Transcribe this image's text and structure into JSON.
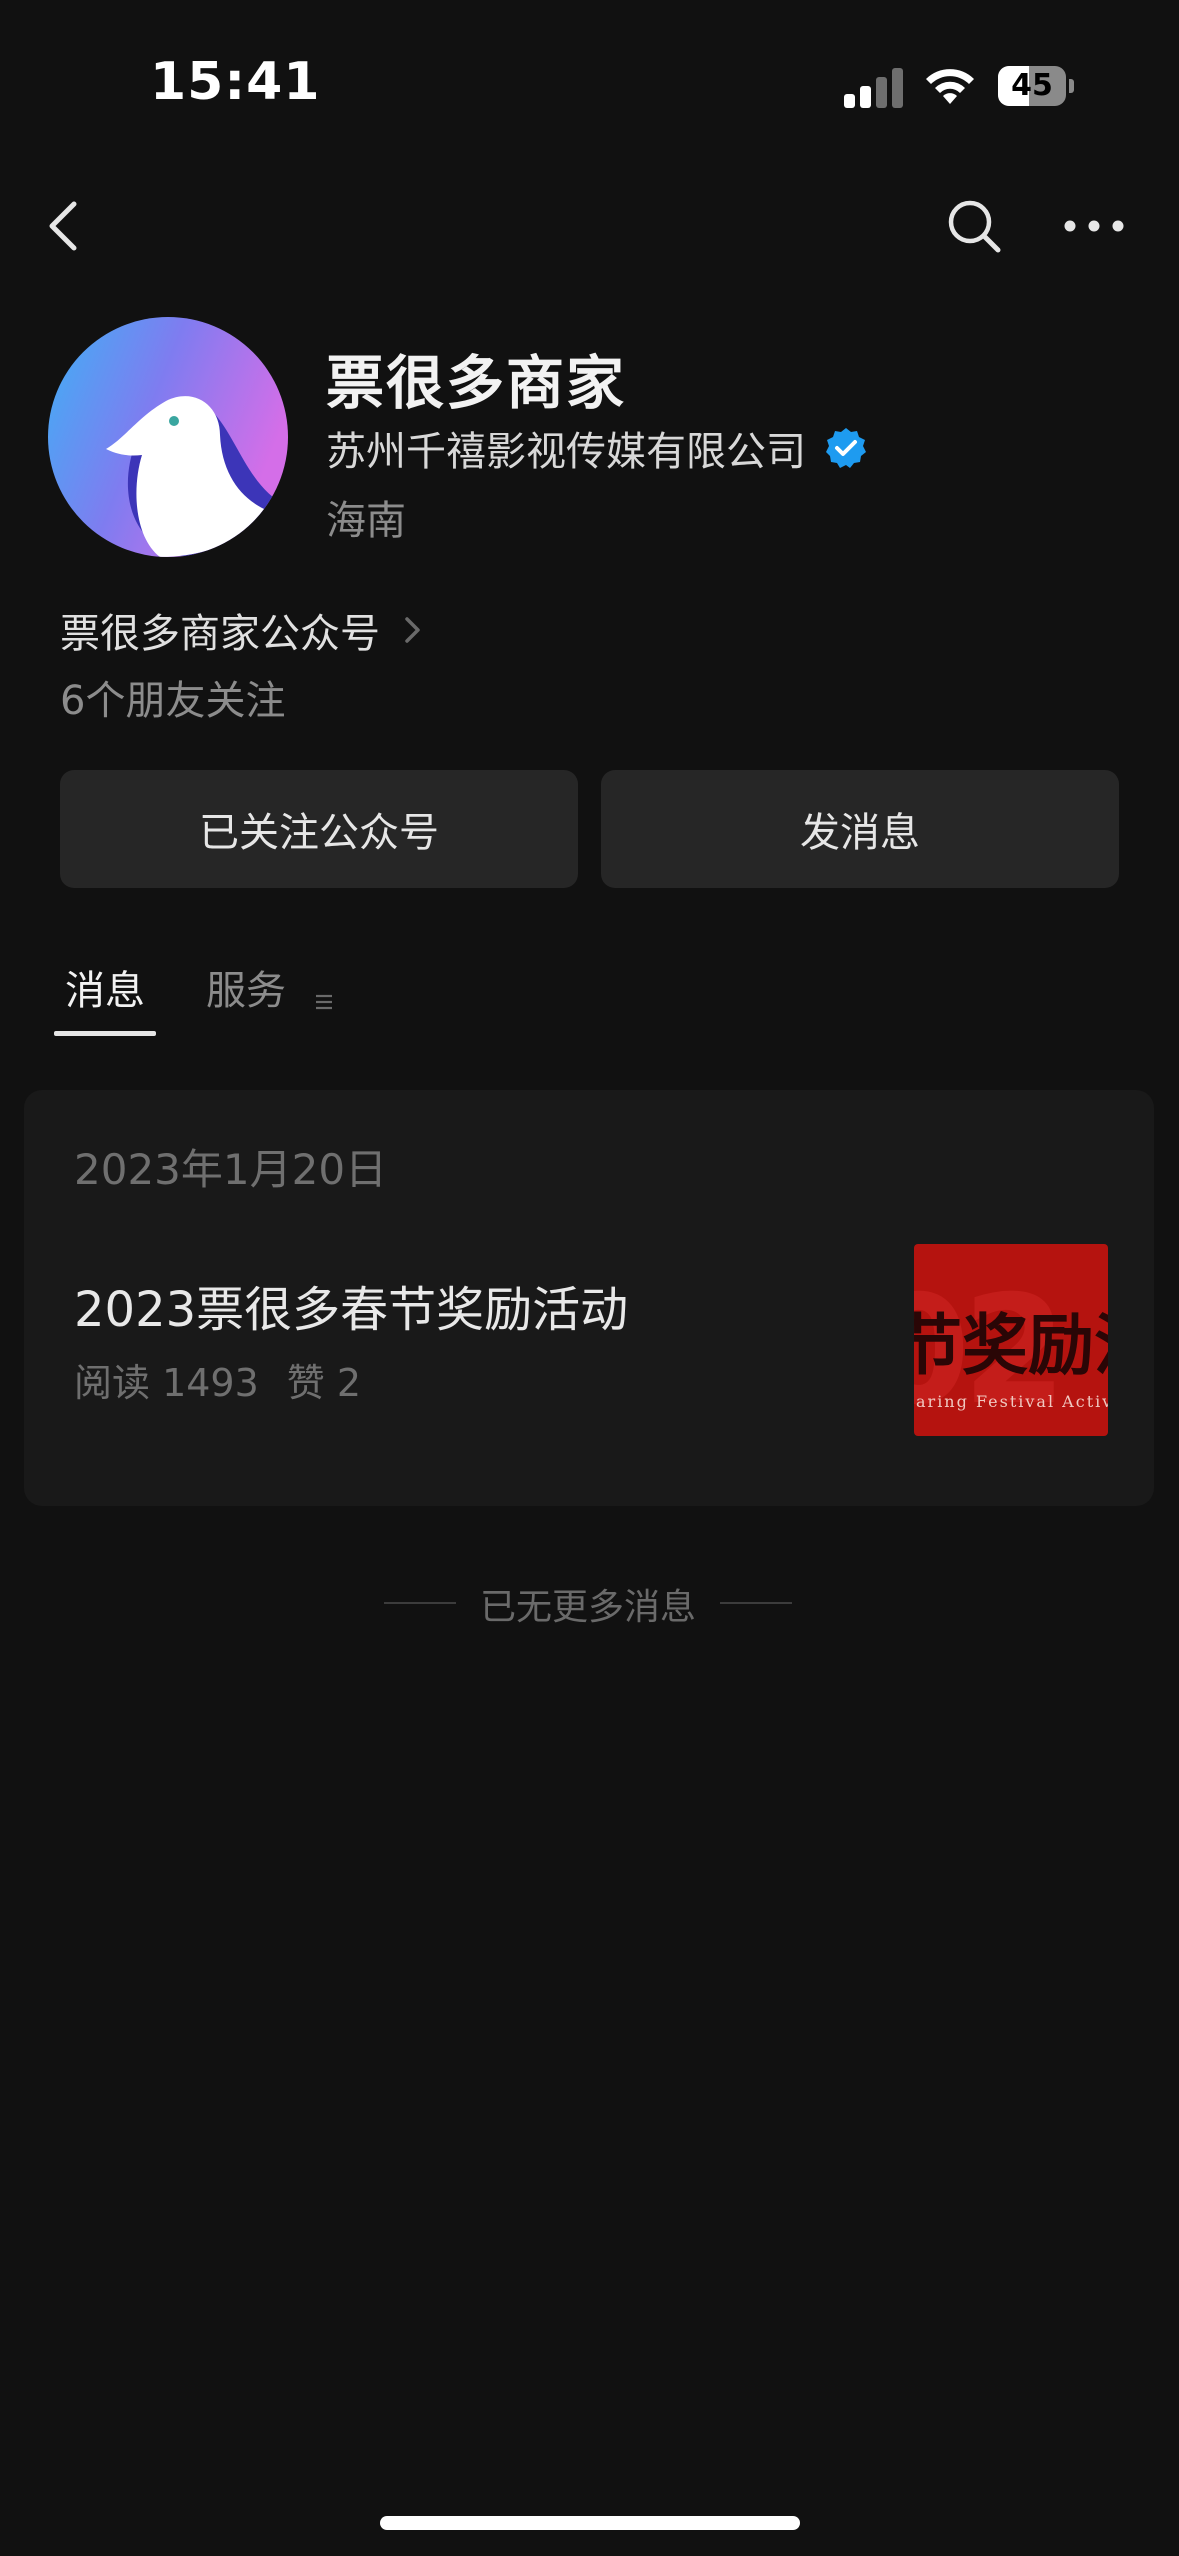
{
  "status_bar": {
    "time": "15:41",
    "battery": "45",
    "battery_level": 0.45,
    "signal_bars": 2,
    "icons": [
      "signal-icon",
      "wifi-icon",
      "battery-icon"
    ]
  },
  "nav": {
    "icons": [
      "back-arrow-icon",
      "search-icon",
      "more-icon"
    ]
  },
  "profile": {
    "name": "票很多商家",
    "company": "苏州千禧影视传媒有限公司",
    "region": "海南",
    "account_link": "票很多商家公众号",
    "friends_following": "6个朋友关注"
  },
  "actions": {
    "followed_label": "已关注公众号",
    "message_label": "发消息"
  },
  "tabs": [
    {
      "label": "消息",
      "active": true
    },
    {
      "label": "服务",
      "active": false
    }
  ],
  "messages": [
    {
      "date": "2023年1月20日",
      "title": "2023票很多春节奖励活动",
      "reads": "阅读 1493",
      "likes": "赞 2",
      "thumbnail": {
        "big_text": "02",
        "text": "节奖励活",
        "subtext": "aring Festival Activit"
      }
    }
  ],
  "end_of_list": "已无更多消息",
  "colors": {
    "background": "#111111",
    "card": "#191919",
    "button": "#262626",
    "verified": "#1e9bf0",
    "thumbnail": "#b5130f"
  }
}
